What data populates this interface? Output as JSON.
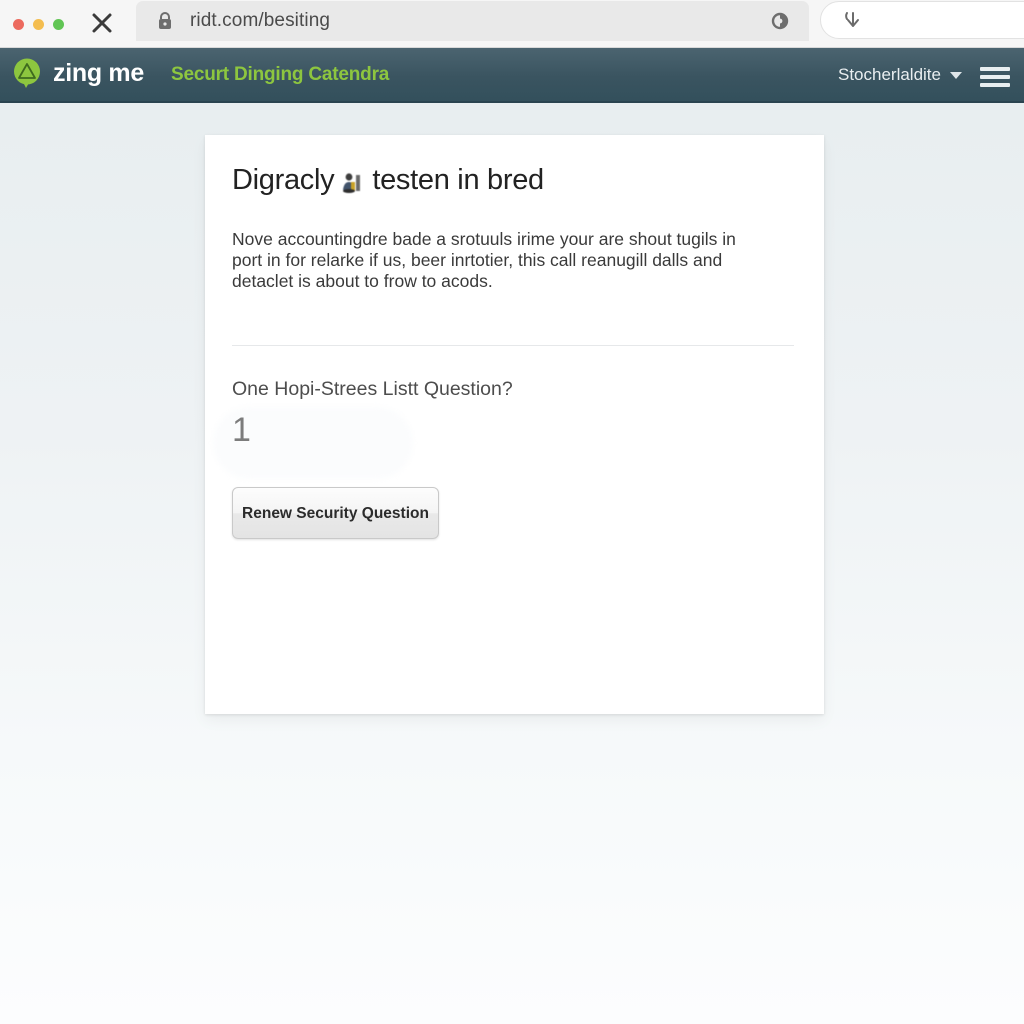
{
  "browser": {
    "url": "ridt.com/besiting",
    "lock_icon": "padlock-icon",
    "reload_icon": "reload-icon",
    "close_icon": "close-tab-icon",
    "download_icon": "download-arrow-icon",
    "traffic_lights": [
      "close-red",
      "minimize-yellow",
      "maximize-green"
    ]
  },
  "navbar": {
    "brand_name": "zing me",
    "logo_icon": "zing-me-logo-icon",
    "tagline": "Securt Dinging Catendra",
    "user_label": "Stocherlaldite",
    "caret_icon": "chevron-down-icon",
    "menu_icon": "hamburger-menu-icon",
    "brand_accent": "#8dc63f",
    "background": "#3a5460"
  },
  "card": {
    "title": "Digracly",
    "title_suffix": "testen in bred",
    "title_emoji": "person-emoji",
    "paragraph": "Nove accountingdre bade a srotuuls irime your are shout tugils in port in for relarke if us, beer inrtotier, this call reanugill dalls and detaclet is about to frow to acods.",
    "question_label": "One Hopi-Strees Listt Question?",
    "answer_value": "1",
    "renew_button_label": "Renew Security Question"
  }
}
